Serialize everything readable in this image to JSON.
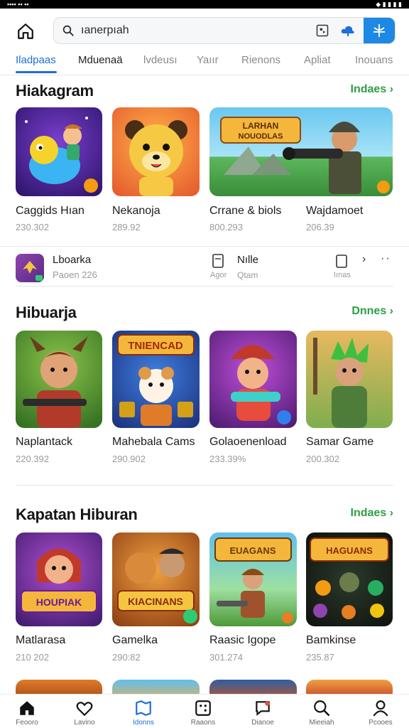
{
  "header": {
    "search_text": "ıanerpıah"
  },
  "tabs": [
    {
      "label": "Iladpaas",
      "active": true
    },
    {
      "label": "Mduenaä",
      "active": false
    },
    {
      "label": "lvdeusı",
      "active": false
    },
    {
      "label": "Yaıır",
      "active": false
    },
    {
      "label": "Rienons",
      "active": false
    },
    {
      "label": "Apliat",
      "active": false
    },
    {
      "label": "Inouans",
      "active": false
    }
  ],
  "section1": {
    "title": "Hiakagram",
    "link": "Indaes",
    "cards": [
      {
        "name": "Caggids Hıan",
        "sub": "230.302"
      },
      {
        "name": "Nekanoja",
        "sub": "289.92"
      },
      {
        "name": "Crrane & biols",
        "sub": "800.293"
      },
      {
        "name": "Wajdamoet",
        "sub": "206.39"
      }
    ]
  },
  "promo": {
    "title": "Lboarka",
    "sub": "Paoen 226",
    "mid_label": "Nılle",
    "mid_sub_a": "Agor",
    "mid_sub_b": "Qtam",
    "right_sub": "Iınas"
  },
  "section2": {
    "title": "Hibuarja",
    "link": "Dnnes",
    "cards": [
      {
        "name": "Naplantack",
        "sub": "220.392"
      },
      {
        "name": "Mahebala Cams",
        "sub": "290.902"
      },
      {
        "name": "Golaoenenload",
        "sub": "233.39%"
      },
      {
        "name": "Samar Game",
        "sub": "200.302"
      }
    ]
  },
  "section3": {
    "title": "Kapatan Hiburan",
    "link": "Indaes",
    "cards": [
      {
        "name": "Matlarasa",
        "sub": "210 202"
      },
      {
        "name": "Gamelka",
        "sub": "290:82"
      },
      {
        "name": "Raasic Igope",
        "sub": "301.274"
      },
      {
        "name": "Bamkinse",
        "sub": "235.87"
      }
    ]
  },
  "bottomnav": [
    {
      "label": "Feooro",
      "icon": "home-icon",
      "active": false
    },
    {
      "label": "Lavino",
      "icon": "heart-icon",
      "active": false
    },
    {
      "label": "Idonns",
      "icon": "map-icon",
      "active": true
    },
    {
      "label": "Raaons",
      "icon": "dice-icon",
      "active": false
    },
    {
      "label": "Dianoe",
      "icon": "chat-icon",
      "active": false
    },
    {
      "label": "Mieeiah",
      "icon": "search-icon",
      "active": false
    },
    {
      "label": "Pcooes",
      "icon": "profile-icon",
      "active": false
    }
  ],
  "colors": {
    "accent": "#1e88e5",
    "link": "#2e9e46"
  }
}
